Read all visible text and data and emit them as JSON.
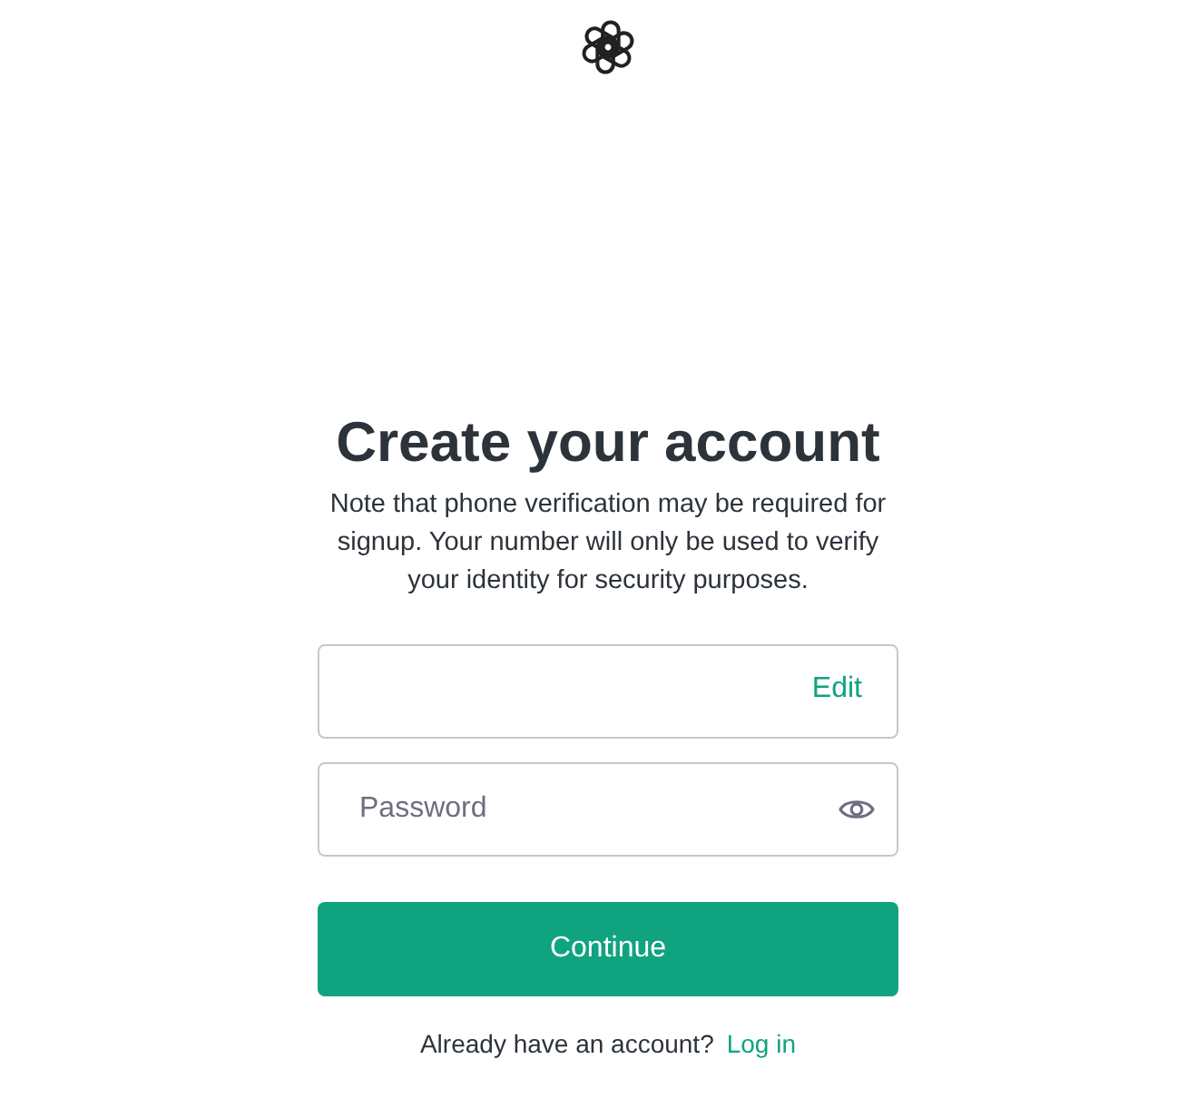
{
  "heading": "Create your account",
  "note": "Note that phone verification may be required for signup. Your number will only be used to verify your identity for security purposes.",
  "email_field": {
    "action": "Edit"
  },
  "password_field": {
    "placeholder": "Password"
  },
  "submit_button": "Continue",
  "footer": {
    "prompt": "Already have an account?",
    "link": "Log in"
  }
}
